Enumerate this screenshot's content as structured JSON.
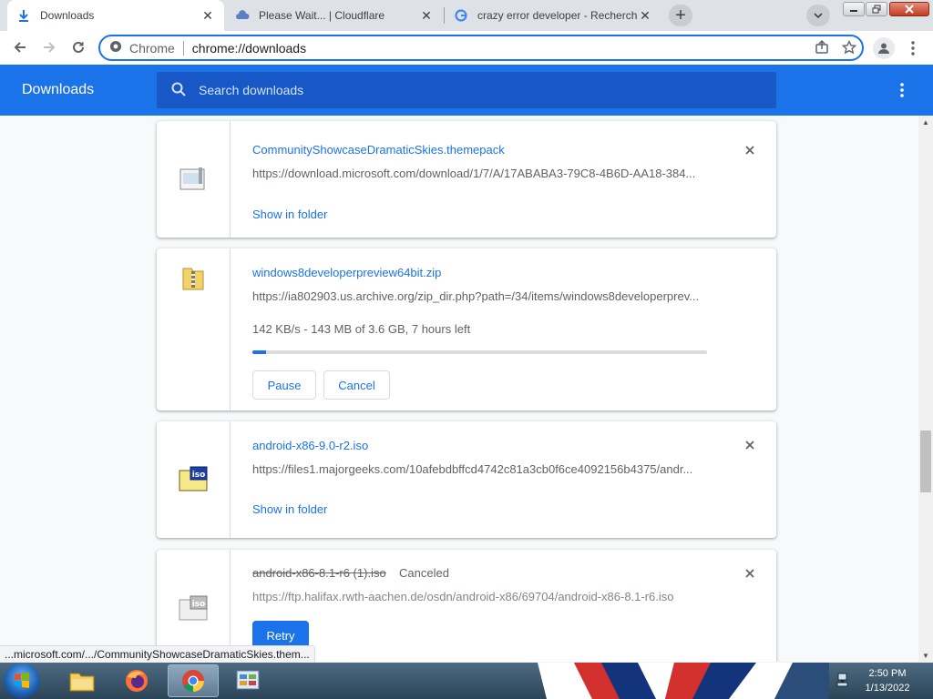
{
  "browser": {
    "tabs": [
      {
        "title": "Downloads",
        "icon": "download-icon",
        "active": true
      },
      {
        "title": "Please Wait... | Cloudflare",
        "icon": "cloudflare-icon",
        "active": false
      },
      {
        "title": "crazy error developer - Recherche",
        "icon": "google-icon",
        "active": false
      }
    ],
    "omnibox": {
      "scheme_label": "Chrome",
      "url": "chrome://downloads"
    }
  },
  "downloads_page": {
    "title": "Downloads",
    "search_placeholder": "Search downloads"
  },
  "downloads": [
    {
      "filename": "CommunityShowcaseDramaticSkies.themepack",
      "url": "https://download.microsoft.com/download/1/7/A/17ABABA3-79C8-4B6D-AA18-384...",
      "link": "Show in folder",
      "icon": "themepack-file-icon"
    },
    {
      "filename": "windows8developerpreview64bit.zip",
      "url": "https://ia802903.us.archive.org/zip_dir.php?path=/34/items/windows8developerprev...",
      "progress_text": "142 KB/s - 143 MB of 3.6 GB, 7 hours left",
      "progress_fraction": 0.03,
      "pause_label": "Pause",
      "cancel_label": "Cancel",
      "icon": "zip-folder-icon"
    },
    {
      "filename": "android-x86-9.0-r2.iso",
      "url": "https://files1.majorgeeks.com/10afebdbffcd4742c81a3cb0f6ce4092156b4375/andr...",
      "link": "Show in folder",
      "icon": "iso-file-icon"
    },
    {
      "filename": "android-x86-8.1-r6 (1).iso",
      "status": "Canceled",
      "url": "https://ftp.halifax.rwth-aachen.de/osdn/android-x86/69704/android-x86-8.1-r6.iso",
      "retry_label": "Retry",
      "icon": "iso-file-icon"
    }
  ],
  "status_bubble": "...microsoft.com/.../CommunityShowcaseDramaticSkies.them...",
  "taskbar": {
    "time": "2:50 PM",
    "date": "1/13/2022"
  },
  "colors": {
    "accent": "#1a73e8",
    "header_search": "#1758c6"
  }
}
